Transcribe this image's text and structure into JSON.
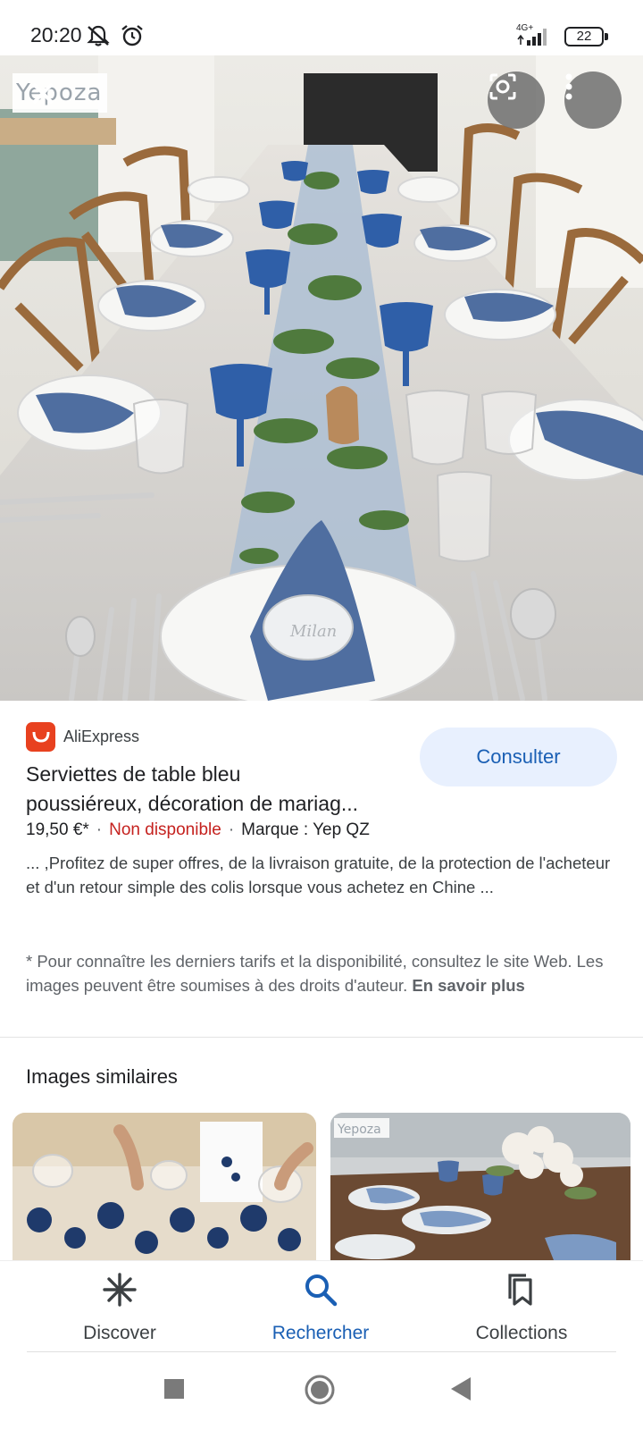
{
  "status_bar": {
    "time": "20:20",
    "network": "4G+",
    "battery": "22"
  },
  "hero": {
    "watermark": "Yepoza",
    "place_card_text": "Milan",
    "icons": [
      "close-icon",
      "lens-icon",
      "more-vert-icon"
    ]
  },
  "product": {
    "source": "AliExpress",
    "title_line1": "Serviettes de table bleu",
    "title_line2": "poussiéreux, décoration de mariag...",
    "price": "19,50 €*",
    "availability": "Non disponible",
    "brand": "Marque : Yep QZ",
    "description": "... ,Profitez de super offres, de la livraison gratuite, de la protection de l'acheteur et d'un retour simple des colis lorsque vous achetez en Chine ...",
    "disclaimer": "* Pour connaître les derniers tarifs et la disponibilité, consultez le site Web. Les images peuvent être soumises à des droits d'auteur.",
    "learn_more": "En savoir plus",
    "consult_button": "Consulter"
  },
  "similar": {
    "title": "Images similaires",
    "thumb2_watermark": "Yepoza"
  },
  "bottom_nav": {
    "items": [
      {
        "label": "Discover",
        "icon": "asterisk-icon"
      },
      {
        "label": "Rechercher",
        "icon": "search-icon"
      },
      {
        "label": "Collections",
        "icon": "collections-icon"
      }
    ],
    "active_index": 1
  },
  "colors": {
    "accent": "#1a5fb4",
    "unavailable": "#c5221f",
    "aliexpress": "#e8411f",
    "button_bg": "#e8f0fe"
  }
}
